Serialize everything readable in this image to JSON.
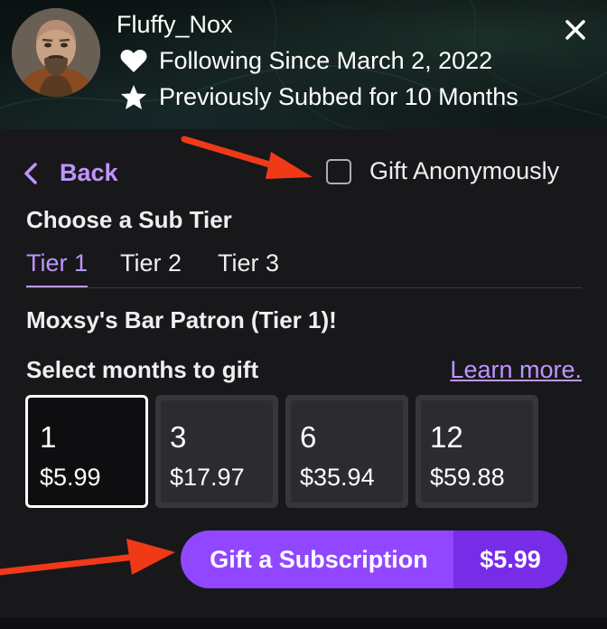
{
  "header": {
    "username": "Fluffy_Nox",
    "following_text": "Following Since March 2, 2022",
    "subbed_text": "Previously Subbed for 10 Months",
    "following_icon": "heart-icon",
    "subbed_icon": "star-icon",
    "close_icon": "close-icon"
  },
  "nav": {
    "back_label": "Back",
    "gift_anonymously_label": "Gift Anonymously",
    "gift_anonymously_checked": false
  },
  "tiers": {
    "title": "Choose a Sub Tier",
    "tabs": [
      {
        "label": "Tier 1",
        "active": true
      },
      {
        "label": "Tier 2",
        "active": false
      },
      {
        "label": "Tier 3",
        "active": false
      }
    ],
    "selected_tier_name": "Moxsy's Bar Patron (Tier 1)!"
  },
  "months": {
    "label": "Select months to gift",
    "learn_more": "Learn more.",
    "options": [
      {
        "months": "1",
        "price": "$5.99",
        "selected": true
      },
      {
        "months": "3",
        "price": "$17.97",
        "selected": false
      },
      {
        "months": "6",
        "price": "$35.94",
        "selected": false
      },
      {
        "months": "12",
        "price": "$59.88",
        "selected": false
      }
    ]
  },
  "cta": {
    "label": "Gift a Subscription",
    "price": "$5.99"
  },
  "colors": {
    "accent": "#bf94ff",
    "button": "#9147ff",
    "button_dark": "#772ce8",
    "background": "#18181b",
    "annotation_arrow": "#f03a17"
  }
}
